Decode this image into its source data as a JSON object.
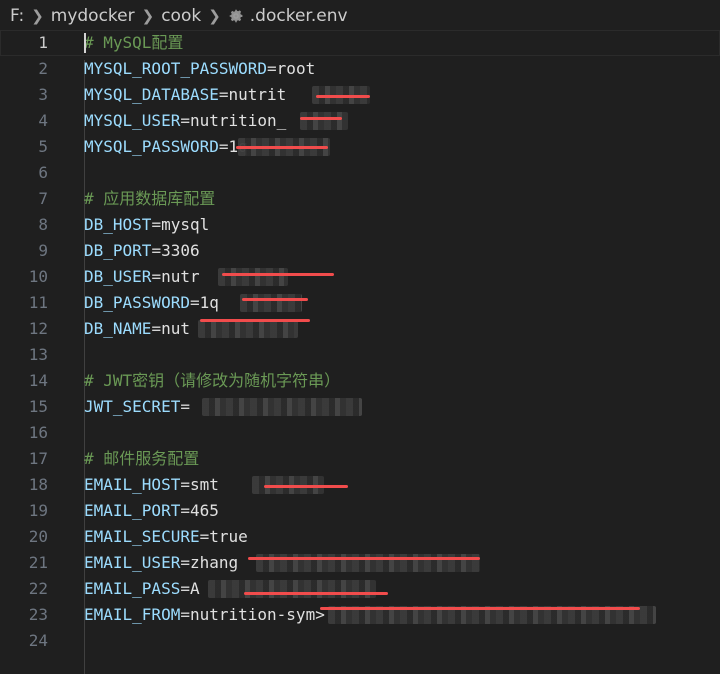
{
  "breadcrumb": {
    "drive": "F:",
    "folder1": "mydocker",
    "folder2": "cook",
    "file": ".docker.env"
  },
  "editor": {
    "lines": [
      {
        "num": "1",
        "parts": [
          {
            "t": "# MySQL配置",
            "c": "c"
          }
        ]
      },
      {
        "num": "2",
        "parts": [
          {
            "t": "MYSQL_ROOT_PASSWORD",
            "c": "k"
          },
          {
            "t": "=",
            "c": "op"
          },
          {
            "t": "root",
            "c": "v"
          }
        ]
      },
      {
        "num": "3",
        "parts": [
          {
            "t": "MYSQL_DATABASE",
            "c": "k"
          },
          {
            "t": "=",
            "c": "op"
          },
          {
            "t": "nutrit",
            "c": "v"
          }
        ]
      },
      {
        "num": "4",
        "parts": [
          {
            "t": "MYSQL_USER",
            "c": "k"
          },
          {
            "t": "=",
            "c": "op"
          },
          {
            "t": "nutrition_",
            "c": "v"
          }
        ]
      },
      {
        "num": "5",
        "parts": [
          {
            "t": "MYSQL_PASSWORD",
            "c": "k"
          },
          {
            "t": "=",
            "c": "op"
          },
          {
            "t": "1q",
            "c": "v"
          }
        ]
      },
      {
        "num": "6",
        "parts": []
      },
      {
        "num": "7",
        "parts": [
          {
            "t": "# 应用数据库配置",
            "c": "c"
          }
        ]
      },
      {
        "num": "8",
        "parts": [
          {
            "t": "DB_HOST",
            "c": "k"
          },
          {
            "t": "=",
            "c": "op"
          },
          {
            "t": "mysql",
            "c": "v"
          }
        ]
      },
      {
        "num": "9",
        "parts": [
          {
            "t": "DB_PORT",
            "c": "k"
          },
          {
            "t": "=",
            "c": "op"
          },
          {
            "t": "3306",
            "c": "v"
          }
        ]
      },
      {
        "num": "10",
        "parts": [
          {
            "t": "DB_USER",
            "c": "k"
          },
          {
            "t": "=",
            "c": "op"
          },
          {
            "t": "nutr",
            "c": "v"
          }
        ]
      },
      {
        "num": "11",
        "parts": [
          {
            "t": "DB_PASSWORD",
            "c": "k"
          },
          {
            "t": "=",
            "c": "op"
          },
          {
            "t": "1q",
            "c": "v"
          }
        ]
      },
      {
        "num": "12",
        "parts": [
          {
            "t": "DB_NAME",
            "c": "k"
          },
          {
            "t": "=",
            "c": "op"
          },
          {
            "t": "nut",
            "c": "v"
          }
        ]
      },
      {
        "num": "13",
        "parts": []
      },
      {
        "num": "14",
        "parts": [
          {
            "t": "# JWT密钥（请修改为随机字符串）",
            "c": "c"
          }
        ]
      },
      {
        "num": "15",
        "parts": [
          {
            "t": "JWT_SECRET",
            "c": "k"
          },
          {
            "t": "=",
            "c": "op"
          }
        ]
      },
      {
        "num": "16",
        "parts": []
      },
      {
        "num": "17",
        "parts": [
          {
            "t": "# 邮件服务配置",
            "c": "c"
          }
        ]
      },
      {
        "num": "18",
        "parts": [
          {
            "t": "EMAIL_HOST",
            "c": "k"
          },
          {
            "t": "=",
            "c": "op"
          },
          {
            "t": "smt",
            "c": "v"
          }
        ]
      },
      {
        "num": "19",
        "parts": [
          {
            "t": "EMAIL_PORT",
            "c": "k"
          },
          {
            "t": "=",
            "c": "op"
          },
          {
            "t": "465",
            "c": "v"
          }
        ]
      },
      {
        "num": "20",
        "parts": [
          {
            "t": "EMAIL_SECURE",
            "c": "k"
          },
          {
            "t": "=",
            "c": "op"
          },
          {
            "t": "true",
            "c": "v"
          }
        ]
      },
      {
        "num": "21",
        "parts": [
          {
            "t": "EMAIL_USER",
            "c": "k"
          },
          {
            "t": "=",
            "c": "op"
          },
          {
            "t": "zhang",
            "c": "v"
          }
        ]
      },
      {
        "num": "22",
        "parts": [
          {
            "t": "EMAIL_PASS",
            "c": "k"
          },
          {
            "t": "=",
            "c": "op"
          },
          {
            "t": "A",
            "c": "v"
          }
        ]
      },
      {
        "num": "23",
        "parts": [
          {
            "t": "EMAIL_FROM",
            "c": "k"
          },
          {
            "t": "=",
            "c": "op"
          },
          {
            "t": "nutrition-sy",
            "c": "v"
          },
          {
            "t": "m>",
            "c": "v"
          }
        ]
      },
      {
        "num": "24",
        "parts": []
      }
    ]
  }
}
